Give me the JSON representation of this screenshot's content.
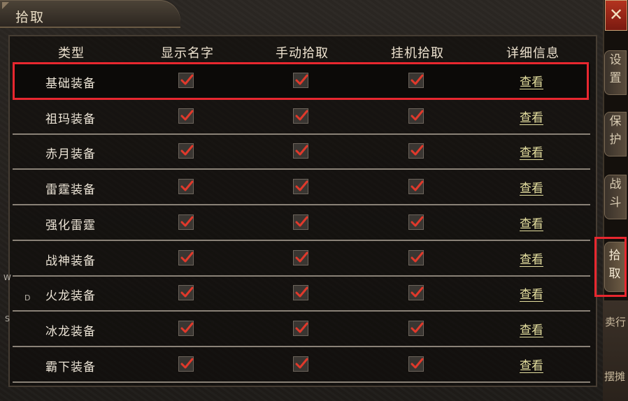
{
  "window": {
    "title": "拾取",
    "close_label": "✕"
  },
  "table": {
    "headers": [
      "类型",
      "显示名字",
      "手动拾取",
      "挂机拾取",
      "详细信息"
    ],
    "view_label": "查看",
    "rows": [
      {
        "type": "基础装备",
        "show_name": true,
        "manual_pickup": true,
        "auto_pickup": true
      },
      {
        "type": "祖玛装备",
        "show_name": true,
        "manual_pickup": true,
        "auto_pickup": true
      },
      {
        "type": "赤月装备",
        "show_name": true,
        "manual_pickup": true,
        "auto_pickup": true
      },
      {
        "type": "雷霆装备",
        "show_name": true,
        "manual_pickup": true,
        "auto_pickup": true
      },
      {
        "type": "强化雷霆",
        "show_name": true,
        "manual_pickup": true,
        "auto_pickup": true
      },
      {
        "type": "战神装备",
        "show_name": true,
        "manual_pickup": true,
        "auto_pickup": true
      },
      {
        "type": "火龙装备",
        "show_name": true,
        "manual_pickup": true,
        "auto_pickup": true
      },
      {
        "type": "冰龙装备",
        "show_name": true,
        "manual_pickup": true,
        "auto_pickup": true
      },
      {
        "type": "霸下装备",
        "show_name": true,
        "manual_pickup": true,
        "auto_pickup": true
      }
    ]
  },
  "side_tabs": [
    {
      "label": "设置",
      "active": false
    },
    {
      "label": "保护",
      "active": false
    },
    {
      "label": "战斗",
      "active": false
    },
    {
      "label": "拾取",
      "active": true
    }
  ],
  "side_extra": {
    "sell_label": "卖行",
    "stall_label": "摆摊"
  },
  "edge_letters": [
    "W",
    "D",
    "S"
  ],
  "colors": {
    "highlight": "#e8272f",
    "check": "#e0392b",
    "link": "#e6e0a0"
  }
}
